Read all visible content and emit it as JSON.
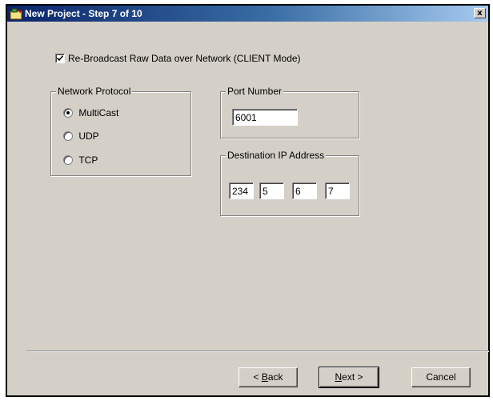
{
  "window": {
    "title": "New Project - Step 7 of 10",
    "close_label": "x"
  },
  "rebroadcast": {
    "label": "Re-Broadcast Raw Data over Network (CLIENT Mode)",
    "checked": true
  },
  "network_protocol": {
    "title": "Network Protocol",
    "options": [
      {
        "label": "MultiCast",
        "selected": true
      },
      {
        "label": "UDP",
        "selected": false
      },
      {
        "label": "TCP",
        "selected": false
      }
    ]
  },
  "port": {
    "title": "Port Number",
    "value": "6001"
  },
  "destination_ip": {
    "title": "Destination IP Address",
    "octets": [
      "234",
      "5",
      "6",
      "7"
    ]
  },
  "buttons": {
    "back_accel": "B",
    "back_rest": "ack",
    "back_prefix": "< ",
    "next_accel": "N",
    "next_rest": "ext >",
    "cancel": "Cancel"
  }
}
